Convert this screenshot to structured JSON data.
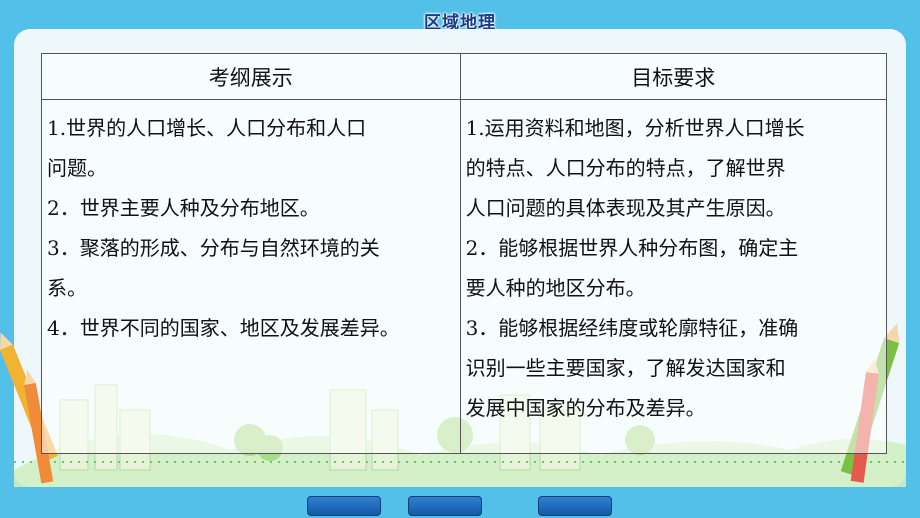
{
  "header": {
    "title": "区域地理"
  },
  "table": {
    "headers": [
      "考纲展示",
      "目标要求"
    ],
    "left_lines": [
      "1.世界的人口增长、人口分布和人口",
      "问题。",
      "2．世界主要人种及分布地区。",
      "3．聚落的形成、分布与自然环境的关",
      "系。",
      "4．世界不同的国家、地区及发展差异。"
    ],
    "right_lines": [
      "1.运用资料和地图，分析世界人口增长",
      "的特点、人口分布的特点，了解世界",
      "人口问题的具体表现及其产生原因。",
      "2．能够根据世界人种分布图，确定主",
      "要人种的地区分布。",
      "3．能够根据经纬度或轮廓特征，准确",
      "识别一些主要国家，了解发达国家和",
      "发展中国家的分布及差异。"
    ]
  },
  "nav": {
    "buttons": [
      "",
      "",
      ""
    ]
  },
  "colors": {
    "background": "#52c0e8",
    "title": "#1a3b8c",
    "nav_button": "#1f6cbf"
  }
}
